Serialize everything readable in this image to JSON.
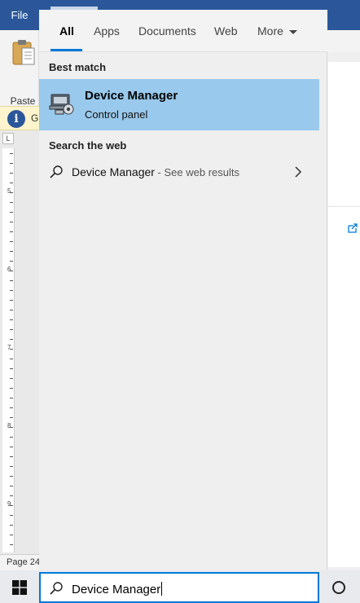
{
  "word": {
    "file_tab": "File",
    "paste_label": "Paste",
    "info_letter": "i",
    "info_text": "G",
    "ruler_corner": "L",
    "ruler_numbers": [
      "5",
      "6",
      "7",
      "8",
      "9"
    ],
    "status_text": "Page 24"
  },
  "search_panel": {
    "tabs": [
      {
        "label": "All",
        "active": true
      },
      {
        "label": "Apps",
        "active": false
      },
      {
        "label": "Documents",
        "active": false
      },
      {
        "label": "Web",
        "active": false
      },
      {
        "label": "More",
        "active": false
      }
    ],
    "best_match_heading": "Best match",
    "best_match": {
      "title": "Device Manager",
      "subtitle": "Control panel",
      "icon": "device-manager-icon"
    },
    "web_heading": "Search the web",
    "web_result": {
      "query": "Device Manager",
      "suffix": " - See web results"
    }
  },
  "taskbar": {
    "search_value": "Device Manager"
  },
  "colors": {
    "accent": "#0078d7",
    "selected_bg": "#99c9ec",
    "word_blue": "#2b579a"
  }
}
